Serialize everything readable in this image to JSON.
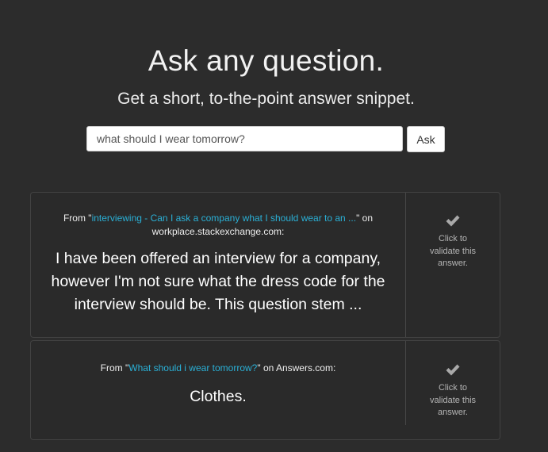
{
  "hero": {
    "title": "Ask any question.",
    "subtitle": "Get a short, to-the-point answer snippet."
  },
  "search": {
    "value": "what should I wear tomorrow?",
    "ask_label": "Ask"
  },
  "answers": [
    {
      "from_prefix": "From \"",
      "link_text": "interviewing - Can I ask a company what I should wear to an ...",
      "from_suffix": "\" on workplace.stackexchange.com:",
      "snippet": "I have been offered an interview for a company, however I'm not sure what the dress code for the interview should be. This question stem ...",
      "validate_label": "Click to validate this answer."
    },
    {
      "from_prefix": "From \"",
      "link_text": "What should i wear tomorrow?",
      "from_suffix": "\" on Answers.com:",
      "snippet": "Clothes.",
      "validate_label": "Click to validate this answer."
    }
  ],
  "colors": {
    "background": "#2c2c2c",
    "link": "#2ab0d6",
    "check_icon": "#a9a9a9"
  }
}
